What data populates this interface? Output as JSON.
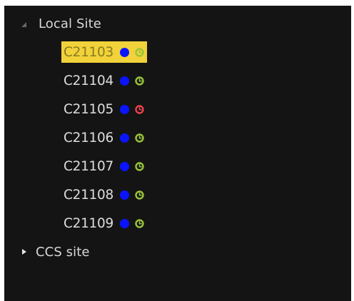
{
  "tree": {
    "local_site": {
      "label": "Local Site",
      "expanded": true,
      "items": [
        {
          "label": "C21103",
          "selected": true,
          "status_color": "#0a14ff",
          "clock_color": "#9ac33a"
        },
        {
          "label": "C21104",
          "selected": false,
          "status_color": "#0a14ff",
          "clock_color": "#9ac33a"
        },
        {
          "label": "C21105",
          "selected": false,
          "status_color": "#0a14ff",
          "clock_color": "#e8414d"
        },
        {
          "label": "C21106",
          "selected": false,
          "status_color": "#0a14ff",
          "clock_color": "#9ac33a"
        },
        {
          "label": "C21107",
          "selected": false,
          "status_color": "#0a14ff",
          "clock_color": "#9ac33a"
        },
        {
          "label": "C21108",
          "selected": false,
          "status_color": "#0a14ff",
          "clock_color": "#9ac33a"
        },
        {
          "label": "C21109",
          "selected": false,
          "status_color": "#0a14ff",
          "clock_color": "#9ac33a"
        }
      ]
    },
    "ccs_site": {
      "label": "CCS site",
      "expanded": false
    }
  },
  "colors": {
    "background": "#141414",
    "selection": "#f2d23a",
    "text": "#d8d8d8"
  },
  "icons": {
    "expanded_node": "triangle-expanded-icon",
    "collapsed_node": "triangle-collapsed-icon",
    "status_dot": "status-dot-icon",
    "clock": "clock-icon"
  }
}
